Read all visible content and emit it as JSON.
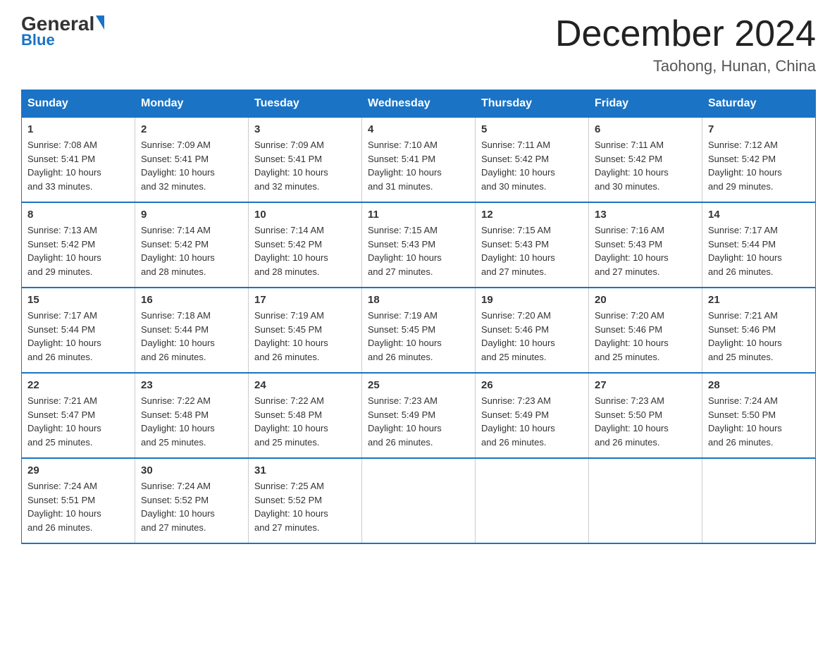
{
  "logo": {
    "general": "General",
    "blue": "Blue"
  },
  "title": "December 2024",
  "location": "Taohong, Hunan, China",
  "days_of_week": [
    "Sunday",
    "Monday",
    "Tuesday",
    "Wednesday",
    "Thursday",
    "Friday",
    "Saturday"
  ],
  "weeks": [
    [
      {
        "day": "1",
        "sunrise": "7:08 AM",
        "sunset": "5:41 PM",
        "daylight": "10 hours and 33 minutes."
      },
      {
        "day": "2",
        "sunrise": "7:09 AM",
        "sunset": "5:41 PM",
        "daylight": "10 hours and 32 minutes."
      },
      {
        "day": "3",
        "sunrise": "7:09 AM",
        "sunset": "5:41 PM",
        "daylight": "10 hours and 32 minutes."
      },
      {
        "day": "4",
        "sunrise": "7:10 AM",
        "sunset": "5:41 PM",
        "daylight": "10 hours and 31 minutes."
      },
      {
        "day": "5",
        "sunrise": "7:11 AM",
        "sunset": "5:42 PM",
        "daylight": "10 hours and 30 minutes."
      },
      {
        "day": "6",
        "sunrise": "7:11 AM",
        "sunset": "5:42 PM",
        "daylight": "10 hours and 30 minutes."
      },
      {
        "day": "7",
        "sunrise": "7:12 AM",
        "sunset": "5:42 PM",
        "daylight": "10 hours and 29 minutes."
      }
    ],
    [
      {
        "day": "8",
        "sunrise": "7:13 AM",
        "sunset": "5:42 PM",
        "daylight": "10 hours and 29 minutes."
      },
      {
        "day": "9",
        "sunrise": "7:14 AM",
        "sunset": "5:42 PM",
        "daylight": "10 hours and 28 minutes."
      },
      {
        "day": "10",
        "sunrise": "7:14 AM",
        "sunset": "5:42 PM",
        "daylight": "10 hours and 28 minutes."
      },
      {
        "day": "11",
        "sunrise": "7:15 AM",
        "sunset": "5:43 PM",
        "daylight": "10 hours and 27 minutes."
      },
      {
        "day": "12",
        "sunrise": "7:15 AM",
        "sunset": "5:43 PM",
        "daylight": "10 hours and 27 minutes."
      },
      {
        "day": "13",
        "sunrise": "7:16 AM",
        "sunset": "5:43 PM",
        "daylight": "10 hours and 27 minutes."
      },
      {
        "day": "14",
        "sunrise": "7:17 AM",
        "sunset": "5:44 PM",
        "daylight": "10 hours and 26 minutes."
      }
    ],
    [
      {
        "day": "15",
        "sunrise": "7:17 AM",
        "sunset": "5:44 PM",
        "daylight": "10 hours and 26 minutes."
      },
      {
        "day": "16",
        "sunrise": "7:18 AM",
        "sunset": "5:44 PM",
        "daylight": "10 hours and 26 minutes."
      },
      {
        "day": "17",
        "sunrise": "7:19 AM",
        "sunset": "5:45 PM",
        "daylight": "10 hours and 26 minutes."
      },
      {
        "day": "18",
        "sunrise": "7:19 AM",
        "sunset": "5:45 PM",
        "daylight": "10 hours and 26 minutes."
      },
      {
        "day": "19",
        "sunrise": "7:20 AM",
        "sunset": "5:46 PM",
        "daylight": "10 hours and 25 minutes."
      },
      {
        "day": "20",
        "sunrise": "7:20 AM",
        "sunset": "5:46 PM",
        "daylight": "10 hours and 25 minutes."
      },
      {
        "day": "21",
        "sunrise": "7:21 AM",
        "sunset": "5:46 PM",
        "daylight": "10 hours and 25 minutes."
      }
    ],
    [
      {
        "day": "22",
        "sunrise": "7:21 AM",
        "sunset": "5:47 PM",
        "daylight": "10 hours and 25 minutes."
      },
      {
        "day": "23",
        "sunrise": "7:22 AM",
        "sunset": "5:48 PM",
        "daylight": "10 hours and 25 minutes."
      },
      {
        "day": "24",
        "sunrise": "7:22 AM",
        "sunset": "5:48 PM",
        "daylight": "10 hours and 25 minutes."
      },
      {
        "day": "25",
        "sunrise": "7:23 AM",
        "sunset": "5:49 PM",
        "daylight": "10 hours and 26 minutes."
      },
      {
        "day": "26",
        "sunrise": "7:23 AM",
        "sunset": "5:49 PM",
        "daylight": "10 hours and 26 minutes."
      },
      {
        "day": "27",
        "sunrise": "7:23 AM",
        "sunset": "5:50 PM",
        "daylight": "10 hours and 26 minutes."
      },
      {
        "day": "28",
        "sunrise": "7:24 AM",
        "sunset": "5:50 PM",
        "daylight": "10 hours and 26 minutes."
      }
    ],
    [
      {
        "day": "29",
        "sunrise": "7:24 AM",
        "sunset": "5:51 PM",
        "daylight": "10 hours and 26 minutes."
      },
      {
        "day": "30",
        "sunrise": "7:24 AM",
        "sunset": "5:52 PM",
        "daylight": "10 hours and 27 minutes."
      },
      {
        "day": "31",
        "sunrise": "7:25 AM",
        "sunset": "5:52 PM",
        "daylight": "10 hours and 27 minutes."
      },
      null,
      null,
      null,
      null
    ]
  ],
  "labels": {
    "sunrise": "Sunrise:",
    "sunset": "Sunset:",
    "daylight": "Daylight:"
  }
}
